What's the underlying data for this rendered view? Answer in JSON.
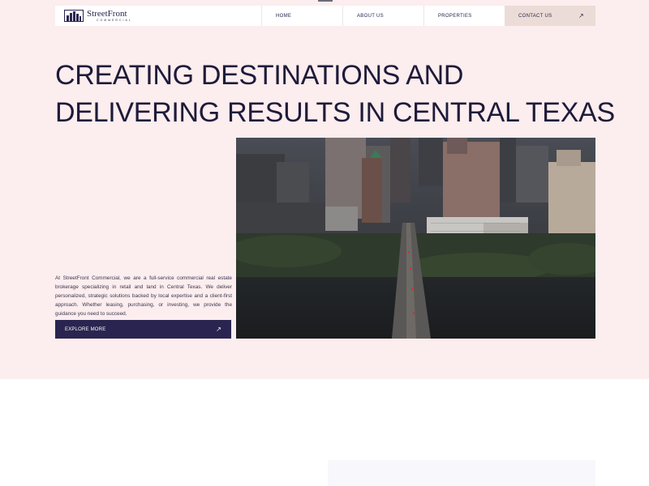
{
  "nav": {
    "logo_name": "StreetFront",
    "logo_sub": "COMMERCIAL",
    "items": [
      {
        "label": "HOME"
      },
      {
        "label": "ABOUT US"
      },
      {
        "label": "PROPERTIES"
      }
    ],
    "contact_label": "CONTACT US"
  },
  "hero": {
    "headline_line1": "CREATING DESTINATIONS AND",
    "headline_line2": "DELIVERING RESULTS IN CENTRAL TEXAS",
    "description": "At StreetFront Commercial, we are a full-service commercial real estate brokerage specializing in retail and land in Central Texas. We deliver personalized, strategic solutions backed by local expertise and a client-first approach. Whether leasing, purchasing, or investing, we provide the guidance you need to succeed.",
    "explore_label": "EXPLORE MORE"
  },
  "colors": {
    "hero_bg": "#fcedee",
    "brand_navy": "#2a2550",
    "contact_bg": "#ebdcd7"
  },
  "icons": {
    "contact": "arrow-up-right-icon",
    "explore": "arrow-up-right-icon"
  }
}
